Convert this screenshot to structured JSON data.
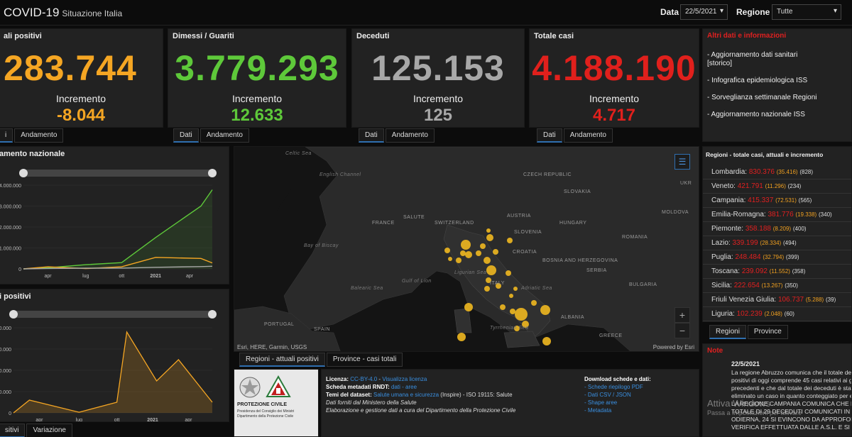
{
  "header": {
    "title": "COVID-19",
    "subtitle": "Situazione Italia",
    "date_label": "Data",
    "date_value": "22/5/2021",
    "region_label": "Regione",
    "region_value": "Tutte"
  },
  "stats": [
    {
      "title": "ali positivi",
      "value": "283.744",
      "increment_label": "Incremento",
      "increment": "-8.044",
      "color": "#f5a623",
      "tabs": [
        "i",
        "Andamento"
      ]
    },
    {
      "title": "Dimessi / Guariti",
      "value": "3.779.293",
      "increment_label": "Incremento",
      "increment": "12.633",
      "color": "#5ec93a",
      "tabs": [
        "Dati",
        "Andamento"
      ]
    },
    {
      "title": "Deceduti",
      "value": "125.153",
      "increment_label": "Incremento",
      "increment": "125",
      "color": "#a8a8a8",
      "tabs": [
        "Dati",
        "Andamento"
      ]
    },
    {
      "title": "Totale casi",
      "value": "4.188.190",
      "increment_label": "Incremento",
      "increment": "4.717",
      "color": "#e0201c",
      "tabs": [
        "Dati",
        "Andamento"
      ]
    }
  ],
  "info": {
    "title": "Altri dati e informazioni",
    "links": [
      "- Aggiornamento dati sanitari [storico]",
      "- Infografica epidemiologica ISS",
      "- Sorveglianza settimanale Regioni",
      "- Aggiornamento nazionale ISS"
    ]
  },
  "regions": {
    "title": "Regioni - totale casi, attuali e incremento",
    "rows": [
      {
        "name": "Lombardia",
        "total": "830.376",
        "current": "(35.416)",
        "inc": "(828)"
      },
      {
        "name": "Veneto",
        "total": "421.791",
        "current": "(11.296)",
        "inc": "(234)"
      },
      {
        "name": "Campania",
        "total": "415.337",
        "current": "(72.531)",
        "inc": "(565)"
      },
      {
        "name": "Emilia-Romagna",
        "total": "381.776",
        "current": "(19.338)",
        "inc": "(340)"
      },
      {
        "name": "Piemonte",
        "total": "358.188",
        "current": "(8.209)",
        "inc": "(400)"
      },
      {
        "name": "Lazio",
        "total": "339.199",
        "current": "(28.334)",
        "inc": "(494)"
      },
      {
        "name": "Puglia",
        "total": "248.484",
        "current": "(32.794)",
        "inc": "(399)"
      },
      {
        "name": "Toscana",
        "total": "239.092",
        "current": "(11.552)",
        "inc": "(358)"
      },
      {
        "name": "Sicilia",
        "total": "222.654",
        "current": "(13.267)",
        "inc": "(350)"
      },
      {
        "name": "Friuli Venezia Giulia",
        "total": "106.737",
        "current": "(5.288)",
        "inc": "(39)"
      },
      {
        "name": "Liguria",
        "total": "102.239",
        "current": "(2.048)",
        "inc": "(60)"
      }
    ],
    "tabs": [
      "Regioni",
      "Province"
    ]
  },
  "note": {
    "title": "Note",
    "date": "22/5/2021",
    "lines": [
      "La regione Abruzzo comunica che il totale dei",
      "positivi di oggi comprende 45 casi relativi ai gi",
      "precedenti e che dal totale dei deceduti è stato",
      "eliminato un caso in quanto conteggiato per er",
      "LA REGIONE CAMPANIA COMUNICA CHE DEI",
      "TOTALE DI 29 DECEDUTI COMUNICATI IN DA",
      "ODIERNA, 24 SI EVINCONO DA APPROFOND",
      "VERIFICA EFFETTUATA DALLE A.S.L. E SI"
    ],
    "watermark": "Attiva Windows",
    "watermark_sub": "Passa a Impostazioni per attivare"
  },
  "charts": {
    "trend": {
      "title": "amento nazionale",
      "yticks": [
        "4.000.000",
        "3.000.000",
        "2.000.000",
        "1.000.000",
        "0"
      ],
      "xticks": [
        "apr",
        "lug",
        "ott",
        "2021",
        "apr"
      ]
    },
    "daily": {
      "title": "i positivi",
      "yticks": [
        "40.000",
        "30.000",
        "20.000",
        "10.000",
        "0"
      ],
      "xticks": [
        "apr",
        "lug",
        "ott",
        "2021",
        "apr"
      ],
      "tabs": [
        "sitivi",
        "Variazione"
      ]
    }
  },
  "chart_data": [
    {
      "type": "line",
      "title": "Andamento nazionale",
      "x": [
        "2020-02",
        "2020-04",
        "2020-07",
        "2020-10",
        "2021-01",
        "2021-04",
        "2021-05"
      ],
      "ylim": [
        0,
        4000000
      ],
      "series": [
        {
          "name": "Dimessi / Guariti",
          "values": [
            0,
            50000,
            200000,
            300000,
            1500000,
            3000000,
            3780000
          ],
          "color": "#5ec93a"
        },
        {
          "name": "Totale positivi",
          "values": [
            0,
            100000,
            15000,
            100000,
            550000,
            500000,
            283744
          ],
          "color": "#f5a623"
        },
        {
          "name": "Deceduti",
          "values": [
            0,
            20000,
            35000,
            37000,
            75000,
            110000,
            125153
          ],
          "color": "#a8a8a8"
        }
      ]
    },
    {
      "type": "area",
      "title": "Nuovi positivi",
      "x": [
        "2020-02",
        "2020-04",
        "2020-07",
        "2020-10",
        "2020-11",
        "2021-01",
        "2021-03",
        "2021-05"
      ],
      "values": [
        0,
        6000,
        300,
        5000,
        38000,
        15000,
        25000,
        5000
      ],
      "ylim": [
        0,
        40000
      ]
    }
  ],
  "map": {
    "tabs": [
      "Regioni - attuali positivi",
      "Province - casi totali"
    ],
    "attribution": "Esri, HERE, Garmin, USGS",
    "powered": "Powered by Esri",
    "labels": [
      {
        "text": "Celtic Sea",
        "sea": true
      },
      {
        "text": "English Channel",
        "sea": true
      },
      {
        "text": "FRANCE",
        "sea": false
      },
      {
        "text": "Bay of Biscay",
        "sea": true
      },
      {
        "text": "PORTUGAL",
        "sea": false
      },
      {
        "text": "SPAIN",
        "sea": false
      },
      {
        "text": "SWITZERLAND",
        "sea": false
      },
      {
        "text": "CZECH REPUBLIC",
        "sea": false
      },
      {
        "text": "SLOVAKIA",
        "sea": false
      },
      {
        "text": "AUSTRIA",
        "sea": false
      },
      {
        "text": "HUNGARY",
        "sea": false
      },
      {
        "text": "SLOVENIA",
        "sea": false
      },
      {
        "text": "CROATIA",
        "sea": false
      },
      {
        "text": "ROMANIA",
        "sea": false
      },
      {
        "text": "MOLDOVA",
        "sea": false
      },
      {
        "text": "BOSNIA AND HERZEGOVINA",
        "sea": false
      },
      {
        "text": "SERBIA",
        "sea": false
      },
      {
        "text": "BULGARIA",
        "sea": false
      },
      {
        "text": "ALBANIA",
        "sea": false
      },
      {
        "text": "GREECE",
        "sea": false
      },
      {
        "text": "Ligurian Sea",
        "sea": true
      },
      {
        "text": "Adriatic Sea",
        "sea": true
      },
      {
        "text": "Tyrrhenian Sea",
        "sea": true
      },
      {
        "text": "Gulf of Lion",
        "sea": true
      },
      {
        "text": "Balearic Sea",
        "sea": true
      },
      {
        "text": "UKR",
        "sea": false
      },
      {
        "text": "SALUTE",
        "sea": false
      },
      {
        "text": "ITALY",
        "sea": false
      }
    ]
  },
  "footer": {
    "logo_caption_1": "PROTEZIONE CIVILE",
    "logo_caption_2": "Presidenza del Consiglio dei Ministri",
    "logo_caption_3": "Dipartimento della Protezione Civile",
    "licenza_label": "Licenza:",
    "licenza_value": "CC-BY-4.0",
    "licenza_link": "Visualizza licenza",
    "scheda_label": "Scheda metadati RNDT:",
    "scheda_links": "dati - aree",
    "temi_label": "Temi del dataset:",
    "temi_value": "Salute umana e sicurezza",
    "temi_rest": "(Inspire) - ISO 19115:",
    "temi_iso": "Salute",
    "line4": "Dati forniti dal Ministero della Salute",
    "line5": "Elaborazione e gestione dati a cura del Dipartimento della Protezione Civile",
    "download_title": "Download schede e dati:",
    "downloads": [
      "- Schede riepilogo PDF",
      "- Dati CSV / JSON",
      "- Shape aree",
      "- Metadata"
    ]
  }
}
